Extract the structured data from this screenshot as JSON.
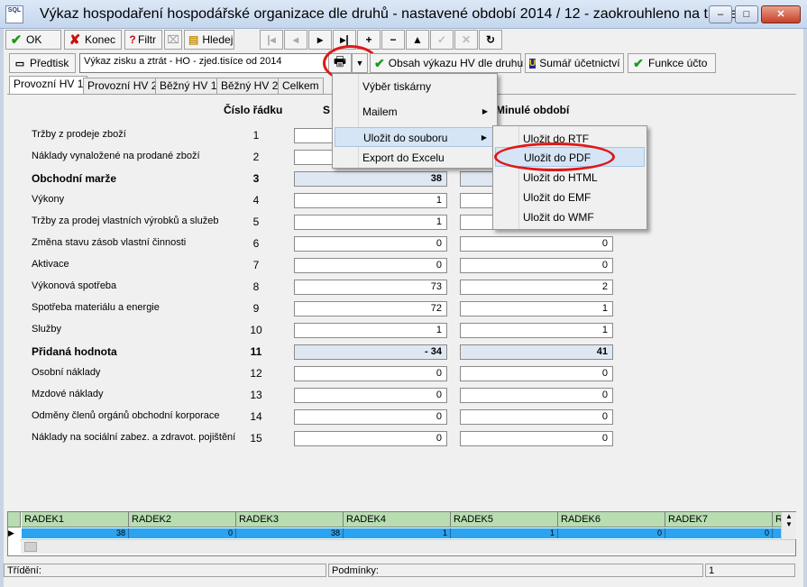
{
  "window": {
    "title": "Výkaz hospodaření hospodářské organizace dle druhů - nastavené období 2014 / 12 - zaokrouhleno na tisíce",
    "logo_text": "SQL",
    "controls": {
      "minimize": "–",
      "maximize": "□",
      "close": "✕"
    }
  },
  "toolbar1": {
    "ok": "OK",
    "konec": "Konec",
    "filtr": "Filtr",
    "hledej": "Hledej",
    "nav": [
      "|◂",
      "◂",
      "▸",
      "▸|",
      "+",
      "−",
      "▲",
      "✓",
      "✕",
      "↻"
    ]
  },
  "toolbar2": {
    "predtisk": "Předtisk",
    "report_combo": "Výkaz zisku a ztrát - HO - zjed.tisíce od 2014",
    "obsah": "Obsah výkazu HV dle druhu",
    "sumar": "Sumář účetnictví",
    "funkce": "Funkce účto"
  },
  "tabs": [
    "Provozní HV 1",
    "Provozní HV 2",
    "Běžný HV 1",
    "Běžný HV 2",
    "Celkem"
  ],
  "columns": {
    "cislo_radku": "Číslo řádku",
    "current_partial": "S",
    "previous": "Minulé období"
  },
  "rows": [
    {
      "label": "Tržby z prodeje zboží",
      "num": "1",
      "cur": "",
      "prev": ""
    },
    {
      "label": "Náklady vynaložené na prodané zboží",
      "num": "2",
      "cur": "",
      "prev": ""
    },
    {
      "label": "Obchodní marže",
      "num": "3",
      "cur": "38",
      "prev": ""
    },
    {
      "label": "Výkony",
      "num": "4",
      "cur": "1",
      "prev": ""
    },
    {
      "label": "Tržby za prodej vlastních výrobků a služeb",
      "num": "5",
      "cur": "1",
      "prev": ""
    },
    {
      "label": "Změna stavu zásob vlastní činnosti",
      "num": "6",
      "cur": "0",
      "prev": "0"
    },
    {
      "label": "Aktivace",
      "num": "7",
      "cur": "0",
      "prev": "0"
    },
    {
      "label": "Výkonová spotřeba",
      "num": "8",
      "cur": "73",
      "prev": "2"
    },
    {
      "label": "Spotřeba materiálu a energie",
      "num": "9",
      "cur": "72",
      "prev": "1"
    },
    {
      "label": "Služby",
      "num": "10",
      "cur": "1",
      "prev": "1"
    },
    {
      "label": "Přidaná hodnota",
      "num": "11",
      "cur": "-   34",
      "prev": "41"
    },
    {
      "label": "Osobní náklady",
      "num": "12",
      "cur": "0",
      "prev": "0"
    },
    {
      "label": "Mzdové náklady",
      "num": "13",
      "cur": "0",
      "prev": "0"
    },
    {
      "label": "Odměny členů orgánů obchodní korporace",
      "num": "14",
      "cur": "0",
      "prev": "0"
    },
    {
      "label": "Náklady na sociální zabez. a zdravot. pojištění",
      "num": "15",
      "cur": "0",
      "prev": "0"
    }
  ],
  "print_menu": {
    "items": [
      "Výběr tiskárny",
      "Mailem",
      "Uložit do souboru",
      "Export do Excelu"
    ]
  },
  "save_submenu": {
    "items": [
      "Uložit do RTF",
      "Uložit do PDF",
      "Uložit do HTML",
      "Uložit do EMF",
      "Uložit do WMF"
    ]
  },
  "grid": {
    "headers": [
      "RADEK1",
      "RADEK2",
      "RADEK3",
      "RADEK4",
      "RADEK5",
      "RADEK6",
      "RADEK7",
      "R"
    ],
    "row": [
      "38",
      "0",
      "38",
      "1",
      "1",
      "0",
      "0",
      ""
    ]
  },
  "statusbar": {
    "trideni": "Třídění:",
    "podminky": "Podmínky:",
    "record": "1"
  },
  "colors": {
    "highlight_circle": "#e01818",
    "grid_header": "#b7ddb0",
    "grid_selected_row": "#2aa3f0"
  }
}
